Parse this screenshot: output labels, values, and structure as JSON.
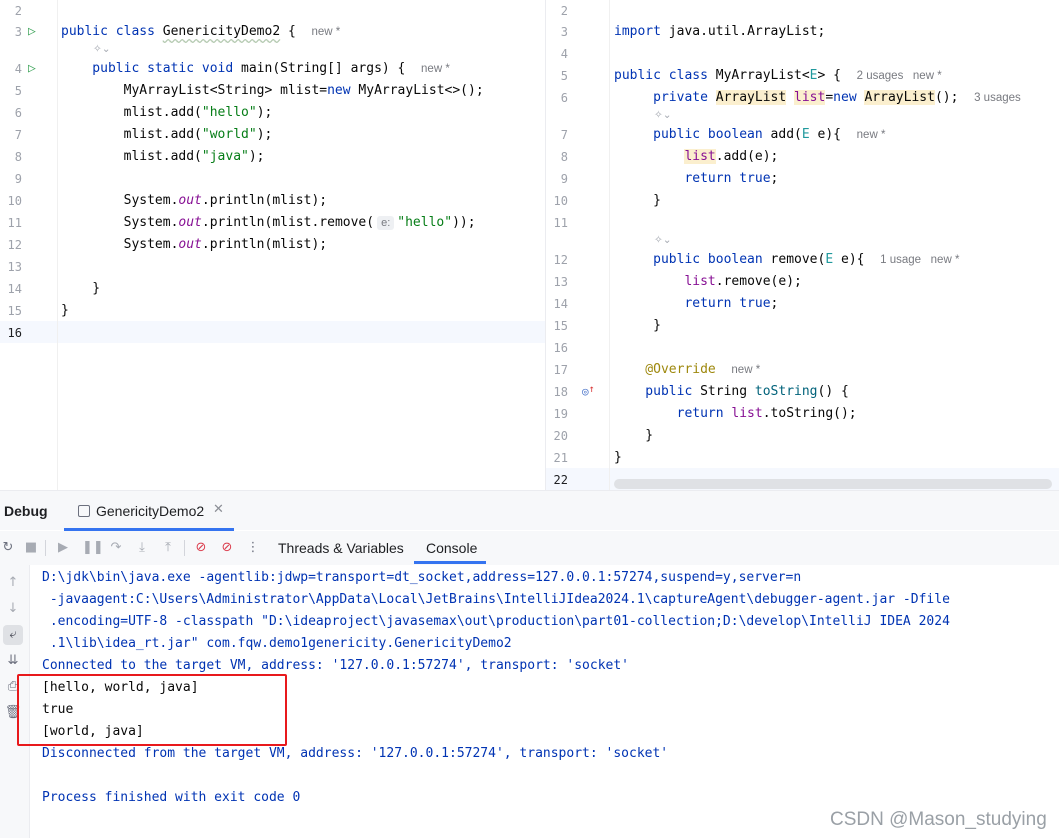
{
  "left_editor": {
    "lines": [
      {
        "no": "2",
        "tokens": []
      },
      {
        "no": "3",
        "run": true,
        "tokens": [
          {
            "t": "public class ",
            "c": "kw"
          },
          {
            "t": "GenericityDemo2",
            "c": "squiggle"
          },
          {
            "t": " {  "
          },
          {
            "t": "new *",
            "c": "hint"
          }
        ]
      },
      {
        "no": "4",
        "run": true,
        "tokens": [
          {
            "t": "    public static void ",
            "c": "kw"
          },
          {
            "t": "main(String[] args) {  "
          },
          {
            "t": "new *",
            "c": "hint"
          }
        ]
      },
      {
        "no": "5",
        "tokens": [
          {
            "t": "        MyArrayList<String> mlist="
          },
          {
            "t": "new ",
            "c": "kw"
          },
          {
            "t": "MyArrayList<>();"
          }
        ]
      },
      {
        "no": "6",
        "tokens": [
          {
            "t": "        mlist.add("
          },
          {
            "t": "\"hello\"",
            "c": "str"
          },
          {
            "t": ");"
          }
        ]
      },
      {
        "no": "7",
        "tokens": [
          {
            "t": "        mlist.add("
          },
          {
            "t": "\"world\"",
            "c": "str"
          },
          {
            "t": ");"
          }
        ]
      },
      {
        "no": "8",
        "tokens": [
          {
            "t": "        mlist.add("
          },
          {
            "t": "\"java\"",
            "c": "str"
          },
          {
            "t": ");"
          }
        ]
      },
      {
        "no": "9",
        "tokens": []
      },
      {
        "no": "10",
        "tokens": [
          {
            "t": "        System."
          },
          {
            "t": "out",
            "c": "field-ital"
          },
          {
            "t": ".println(mlist);"
          }
        ]
      },
      {
        "no": "11",
        "tokens": [
          {
            "t": "        System."
          },
          {
            "t": "out",
            "c": "field-ital"
          },
          {
            "t": ".println(mlist.remove("
          },
          {
            "t": "e:",
            "c": "param-hint"
          },
          {
            "t": "\"hello\"",
            "c": "str"
          },
          {
            "t": "));"
          }
        ]
      },
      {
        "no": "12",
        "tokens": [
          {
            "t": "        System."
          },
          {
            "t": "out",
            "c": "field-ital"
          },
          {
            "t": ".println(mlist);"
          }
        ]
      },
      {
        "no": "13",
        "tokens": []
      },
      {
        "no": "14",
        "tokens": [
          {
            "t": "    }"
          }
        ]
      },
      {
        "no": "15",
        "tokens": [
          {
            "t": "}"
          }
        ]
      },
      {
        "no": "16",
        "current": true,
        "tokens": []
      }
    ]
  },
  "right_editor": {
    "lines": [
      {
        "no": "2",
        "tokens": []
      },
      {
        "no": "3",
        "tokens": [
          {
            "t": "import ",
            "c": "kw"
          },
          {
            "t": "java.util.ArrayList;"
          }
        ]
      },
      {
        "no": "4",
        "tokens": []
      },
      {
        "no": "5",
        "tokens": [
          {
            "t": "public class ",
            "c": "kw"
          },
          {
            "t": "MyArrayList<"
          },
          {
            "t": "E",
            "c": "typeparam"
          },
          {
            "t": "> {  "
          },
          {
            "t": "2 usages   new *",
            "c": "hint"
          }
        ]
      },
      {
        "no": "6",
        "tokens": [
          {
            "t": "     private ",
            "c": "kw"
          },
          {
            "t": "ArrayList",
            "c": "hl-bg"
          },
          {
            "t": " "
          },
          {
            "t": "list",
            "c": "fld hl-bg"
          },
          {
            "t": "="
          },
          {
            "t": "new ",
            "c": "kw"
          },
          {
            "t": "ArrayList",
            "c": "hl-bg"
          },
          {
            "t": "();  "
          },
          {
            "t": "3 usages",
            "c": "hint"
          }
        ]
      },
      {
        "no": "7",
        "tokens": [
          {
            "t": "     public boolean ",
            "c": "kw"
          },
          {
            "t": "add(",
            "c": ""
          },
          {
            "t": "E",
            "c": "typeparam"
          },
          {
            "t": " e){  "
          },
          {
            "t": "new *",
            "c": "hint"
          }
        ]
      },
      {
        "no": "8",
        "tokens": [
          {
            "t": "         "
          },
          {
            "t": "list",
            "c": "fld hl-bg"
          },
          {
            "t": ".add(e);"
          }
        ]
      },
      {
        "no": "9",
        "tokens": [
          {
            "t": "         return true",
            "c": "kw"
          },
          {
            "t": ";"
          }
        ]
      },
      {
        "no": "10",
        "tokens": [
          {
            "t": "     }"
          }
        ]
      },
      {
        "no": "11",
        "tokens": []
      },
      {
        "no": "12",
        "tokens": [
          {
            "t": "     public boolean ",
            "c": "kw"
          },
          {
            "t": "remove("
          },
          {
            "t": "E",
            "c": "typeparam"
          },
          {
            "t": " e){  "
          },
          {
            "t": "1 usage   new *",
            "c": "hint"
          }
        ]
      },
      {
        "no": "13",
        "tokens": [
          {
            "t": "         "
          },
          {
            "t": "list",
            "c": "fld"
          },
          {
            "t": ".remove(e);"
          }
        ]
      },
      {
        "no": "14",
        "tokens": [
          {
            "t": "         return true",
            "c": "kw"
          },
          {
            "t": ";"
          }
        ]
      },
      {
        "no": "15",
        "tokens": [
          {
            "t": "     }"
          }
        ]
      },
      {
        "no": "16",
        "tokens": []
      },
      {
        "no": "17",
        "tokens": [
          {
            "t": "    @Override",
            "c": "anno"
          },
          {
            "t": "  "
          },
          {
            "t": "new *",
            "c": "hint"
          }
        ]
      },
      {
        "no": "18",
        "override": true,
        "tokens": [
          {
            "t": "    public ",
            "c": "kw"
          },
          {
            "t": "String "
          },
          {
            "t": "toString",
            "c": "meth"
          },
          {
            "t": "() {"
          }
        ]
      },
      {
        "no": "19",
        "tokens": [
          {
            "t": "        return ",
            "c": "kw"
          },
          {
            "t": "list",
            "c": "fld"
          },
          {
            "t": ".toString();"
          }
        ]
      },
      {
        "no": "20",
        "tokens": [
          {
            "t": "    }"
          }
        ]
      },
      {
        "no": "21",
        "tokens": [
          {
            "t": "}"
          }
        ]
      },
      {
        "no": "22",
        "current": true,
        "tokens": []
      }
    ]
  },
  "debug": {
    "title": "Debug",
    "session_tab": "GenericityDemo2",
    "subtabs": [
      "Threads & Variables",
      "Console"
    ],
    "active_subtab": "Console",
    "console_lines": [
      {
        "text": "D:\\jdk\\bin\\java.exe -agentlib:jdwp=transport=dt_socket,address=127.0.0.1:57274,suspend=y,server=n",
        "kind": "sys"
      },
      {
        "text": " -javaagent:C:\\Users\\Administrator\\AppData\\Local\\JetBrains\\IntelliJIdea2024.1\\captureAgent\\debugger-agent.jar -Dfile",
        "kind": "sys"
      },
      {
        "text": " .encoding=UTF-8 -classpath \"D:\\ideaproject\\javasemax\\out\\production\\part01-collection;D:\\develop\\IntelliJ IDEA 2024",
        "kind": "sys"
      },
      {
        "text": " .1\\lib\\idea_rt.jar\" com.fqw.demo1genericity.GenericityDemo2",
        "kind": "sys"
      },
      {
        "text": "Connected to the target VM, address: '127.0.0.1:57274', transport: 'socket'",
        "kind": "sys"
      },
      {
        "text": "[hello, world, java]",
        "kind": "out"
      },
      {
        "text": "true",
        "kind": "out"
      },
      {
        "text": "[world, java]",
        "kind": "out"
      },
      {
        "text": "Disconnected from the target VM, address: '127.0.0.1:57274', transport: 'socket'",
        "kind": "sys"
      },
      {
        "text": "",
        "kind": "out"
      },
      {
        "text": "Process finished with exit code 0",
        "kind": "sys"
      }
    ]
  },
  "watermark": "CSDN @Mason_studying",
  "colors": {
    "accent": "#3574f0",
    "highlight_box": "#e8191c",
    "run": "#3fa55b"
  }
}
